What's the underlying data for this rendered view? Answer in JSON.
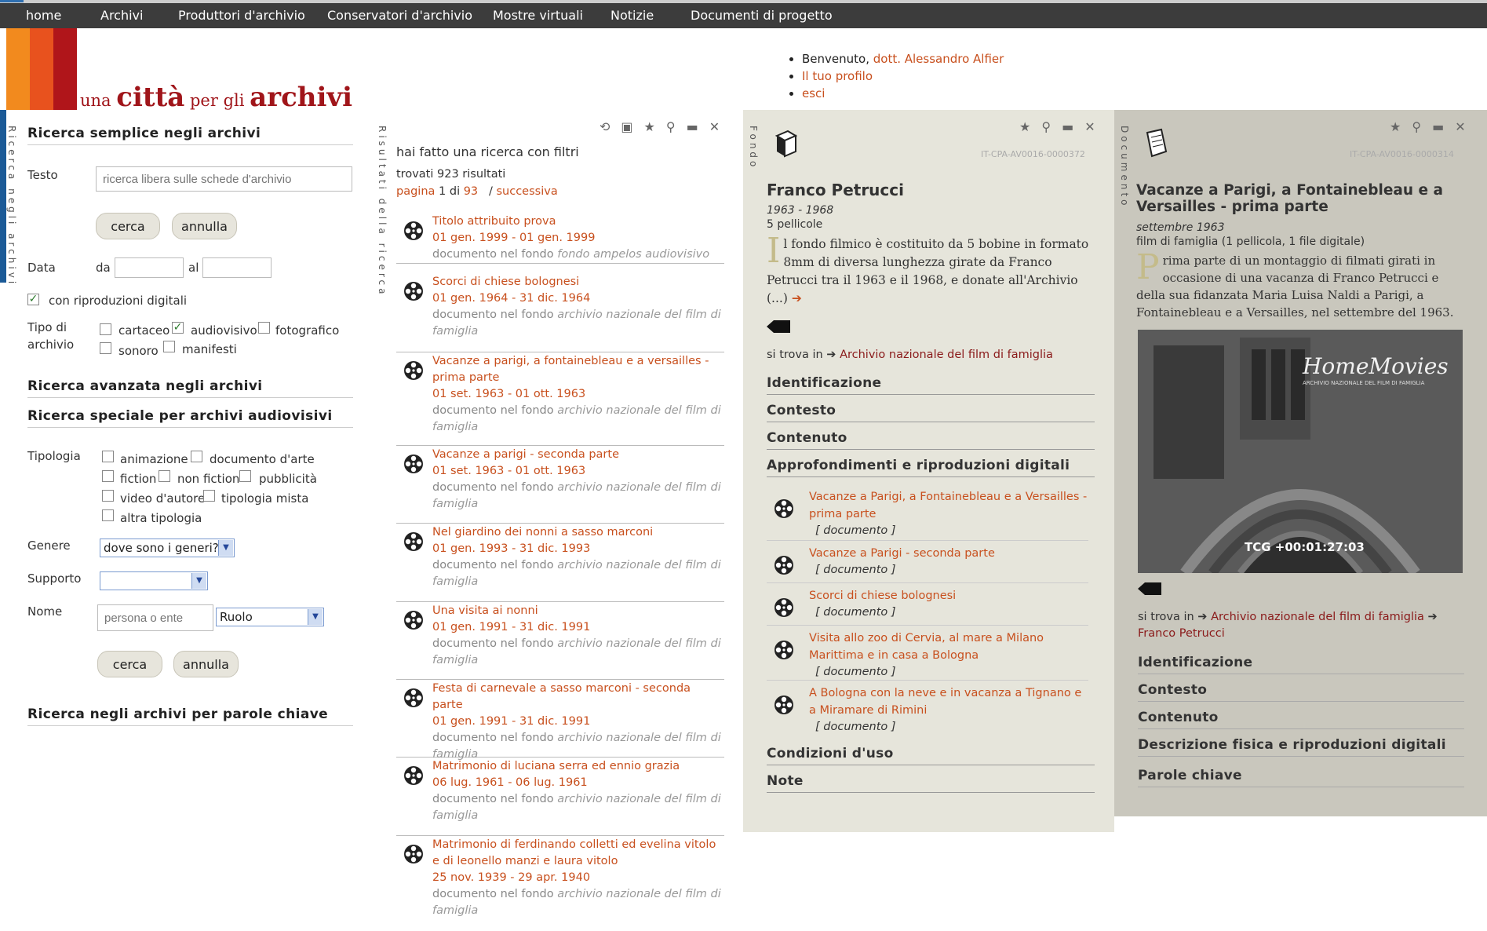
{
  "nav": {
    "items": [
      "home",
      "Archivi",
      "Produttori d'archivio",
      "Conservatori d'archivio",
      "Mostre virtuali",
      "Notizie",
      "Documenti di progetto"
    ]
  },
  "header": {
    "logo": {
      "part1": "una ",
      "part2": "città",
      "part3": " per gli ",
      "part4": "archivi"
    },
    "user": {
      "welcome": "Benvenuto, ",
      "user_name": "dott. Alessandro Alfier",
      "profile": "Il tuo profilo",
      "logout": "esci"
    }
  },
  "colors": {
    "accent": "#c8501e",
    "nav_bg": "#3c3c3c",
    "logo_red": "#a0151a"
  },
  "search": {
    "vertical_label": "Ricerca negli archivi",
    "simple_title": "Ricerca semplice negli archivi",
    "testo_label": "Testo",
    "testo_placeholder": "ricerca libera sulle schede d'archivio",
    "cerca": "cerca",
    "annulla": "annulla",
    "data_label": "Data",
    "da": "da",
    "al": "al",
    "digital_label": "con riproduzioni digitali",
    "tipo_label_1": "Tipo di",
    "tipo_label_2": "archivio",
    "tipo": {
      "cartaceo": "cartaceo",
      "audiovisivo": "audiovisivo",
      "fotografico": "fotografico",
      "sonoro": "sonoro",
      "manifesti": "manifesti"
    },
    "advanced_title": "Ricerca avanzata negli archivi",
    "special_title": "Ricerca speciale per archivi audiovisivi",
    "tipologia_label": "Tipologia",
    "tipologia": {
      "animazione": "animazione",
      "documento_arte": "documento d'arte",
      "fiction": "fiction",
      "non_fiction": "non fiction",
      "pubblicita": "pubblicità",
      "video_autore": "video d'autore",
      "tipologia_mista": "tipologia mista",
      "altra": "altra tipologia"
    },
    "genere_label": "Genere",
    "genere_value": "dove sono i generi?",
    "supporto_label": "Supporto",
    "supporto_value": "",
    "nome_label": "Nome",
    "nome_placeholder": "persona o ente",
    "ruolo_value": "Ruolo",
    "keyword_title": "Ricerca negli archivi per parole chiave"
  },
  "results": {
    "vertical_label": "Risultati della ricerca",
    "intro": "hai fatto una ricerca con filtri",
    "count": "trovati 923 risultati",
    "page_label": "pagina",
    "page_num": "1",
    "of": "di",
    "page_total": "93",
    "next_sep": "/",
    "next": "successiva",
    "items": [
      {
        "title": "Titolo attribuito prova",
        "date": "01 gen. 1999 - 01 gen. 1999",
        "doc": "documento nel fondo ",
        "fondo": "fondo ampelos   audiovisivo"
      },
      {
        "title": "Scorci di chiese bolognesi",
        "date": "01 gen. 1964 - 31 dic. 1964",
        "doc": "documento nel fondo ",
        "fondo": "archivio nazionale del film di famiglia"
      },
      {
        "title": "Vacanze a parigi, a fontainebleau e a versailles - prima parte",
        "date": "01 set. 1963 - 01 ott. 1963",
        "doc": "documento nel fondo ",
        "fondo": "archivio nazionale del film di famiglia"
      },
      {
        "title": "Vacanze a parigi - seconda parte",
        "date": "01 set. 1963 - 01 ott. 1963",
        "doc": "documento nel fondo ",
        "fondo": "archivio nazionale del film di famiglia"
      },
      {
        "title": "Nel giardino dei nonni a sasso marconi",
        "date": "01 gen. 1993 - 31 dic. 1993",
        "doc": "documento nel fondo ",
        "fondo": "archivio nazionale del film di famiglia"
      },
      {
        "title": "Una visita ai nonni",
        "date": "01 gen. 1991 - 31 dic. 1991",
        "doc": "documento nel fondo ",
        "fondo": "archivio nazionale del film di famiglia"
      },
      {
        "title": "Festa di carnevale a sasso marconi - seconda parte",
        "date": "01 gen. 1991 - 31 dic. 1991",
        "doc": "documento nel fondo ",
        "fondo": "archivio nazionale del film di famiglia"
      },
      {
        "title": "Matrimonio di luciana serra ed ennio grazia",
        "date": "06 lug. 1961 - 06 lug. 1961",
        "doc": "documento nel fondo ",
        "fondo": "archivio nazionale del film di famiglia"
      },
      {
        "title": "Matrimonio di ferdinando colletti ed evelina vitolo e di leonello manzi e laura vitolo",
        "date": "25 nov. 1939 - 29 apr. 1940",
        "doc": "documento nel fondo ",
        "fondo": "archivio nazionale del film di famiglia"
      }
    ]
  },
  "fondo": {
    "vertical_label": "Fondo",
    "code": "IT-CPA-AV0016-0000372",
    "title": "Franco Petrucci",
    "years": "1963 - 1968",
    "extent": "5 pellicole",
    "dropcap": "I",
    "body": "l fondo filmico è costituito da 5 bobine in formato 8mm di diversa lunghezza girate da Franco Petrucci tra il 1963 e il 1968, e donate all'Archivio (...)",
    "arrow": "➔",
    "location_label": "si trova in ➔ ",
    "location": "Archivio nazionale del film di famiglia",
    "sections": [
      "Identificazione",
      "Contesto",
      "Contenuto",
      "Approfondimenti e riproduzioni digitali"
    ],
    "docs": [
      {
        "title": "Vacanze a Parigi, a Fontainebleau e a Versailles - prima parte",
        "type": "[ documento ]"
      },
      {
        "title": "Vacanze a Parigi - seconda parte",
        "type": "[ documento ]"
      },
      {
        "title": "Scorci di chiese bolognesi",
        "type": "[ documento ]"
      },
      {
        "title": "Visita allo zoo di Cervia, al mare a Milano Marittima e in casa a Bologna",
        "type": "[ documento ]"
      },
      {
        "title": "A Bologna con la neve e in vacanza a Tignano e a Miramare di Rimini",
        "type": "[ documento ]"
      }
    ],
    "sections_after": [
      "Condizioni d'uso",
      "Note"
    ]
  },
  "documento": {
    "vertical_label": "Documento",
    "code": "IT-CPA-AV0016-0000314",
    "title": "Vacanze a Parigi, a Fontainebleau e a Versailles - prima parte",
    "date": "settembre 1963",
    "extent": "film di famiglia (1 pellicola, 1 file digitale)",
    "dropcap": "P",
    "body": "rima parte di un montaggio di filmati girati in occasione di una vacanza di Franco Petrucci e della sua fidanzata Maria Luisa Naldi a Parigi, a Fontainebleau e a Versailles, nel settembre del 1963.",
    "video": {
      "brand": "HomeMovies",
      "brand_sub": "ARCHIVIO NAZIONALE DEL FILM DI FAMIGLIA",
      "timecode": "TCG +00:01:27:03"
    },
    "location_label": "si trova in ➔ ",
    "location_1": "Archivio nazionale del film di famiglia",
    "location_sep": " ➔ ",
    "location_2": "Franco Petrucci",
    "sections": [
      "Identificazione",
      "Contesto",
      "Contenuto",
      "Descrizione fisica e riproduzioni digitali",
      "Parole chiave"
    ]
  }
}
